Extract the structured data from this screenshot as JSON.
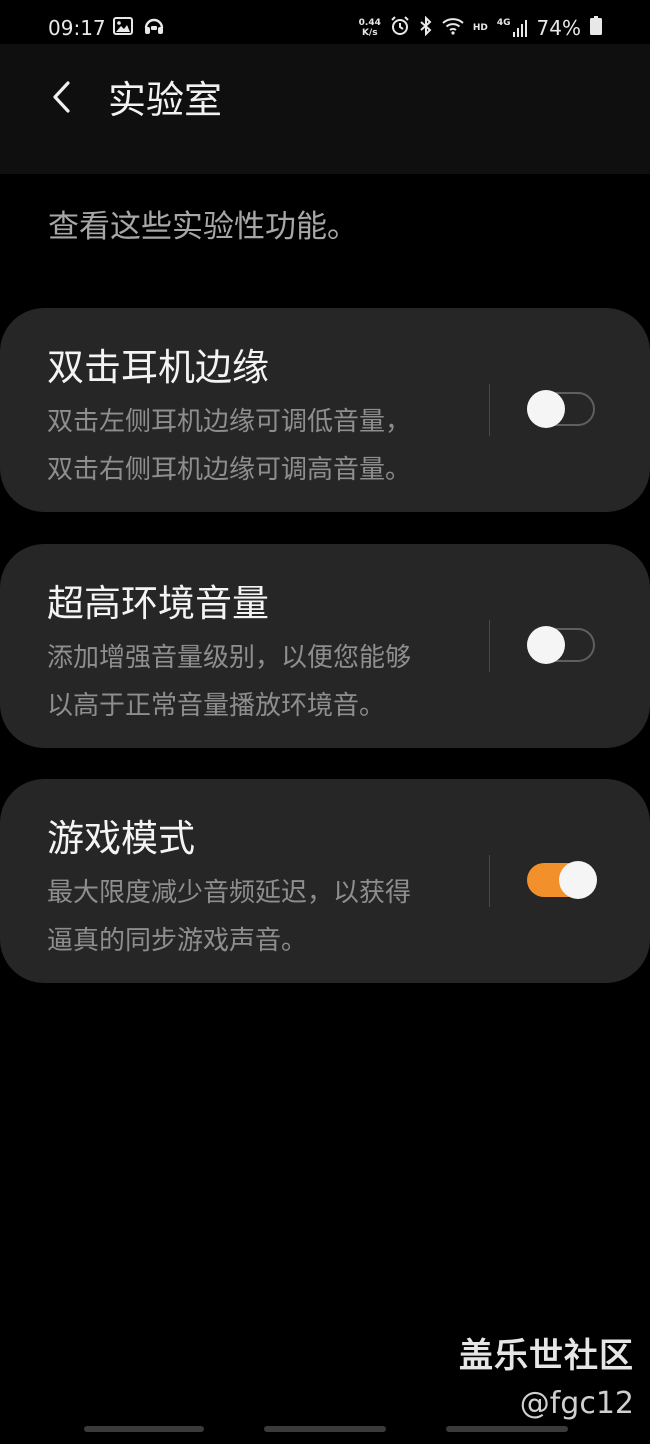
{
  "status_bar": {
    "time": "09:17",
    "speed_value": "0.44",
    "speed_unit": "K/s",
    "hd_label": "HD",
    "network_label": "4G",
    "battery": "74%"
  },
  "header": {
    "title": "实验室"
  },
  "description": "查看这些实验性功能。",
  "features": [
    {
      "title": "双击耳机边缘",
      "desc_line1": "双击左侧耳机边缘可调低音量，",
      "desc_line2": "双击右侧耳机边缘可调高音量。",
      "enabled": false
    },
    {
      "title": "超高环境音量",
      "desc_line1": "添加增强音量级别，以便您能够",
      "desc_line2": "以高于正常音量播放环境音。",
      "enabled": false
    },
    {
      "title": "游戏模式",
      "desc_line1": "最大限度减少音频延迟，以获得",
      "desc_line2": "逼真的同步游戏声音。",
      "enabled": true
    }
  ],
  "watermark": {
    "site": "盖乐世社区",
    "user": "@fgc12"
  },
  "colors": {
    "accent": "#f2912b",
    "card_bg": "#262626",
    "background": "#000000"
  }
}
